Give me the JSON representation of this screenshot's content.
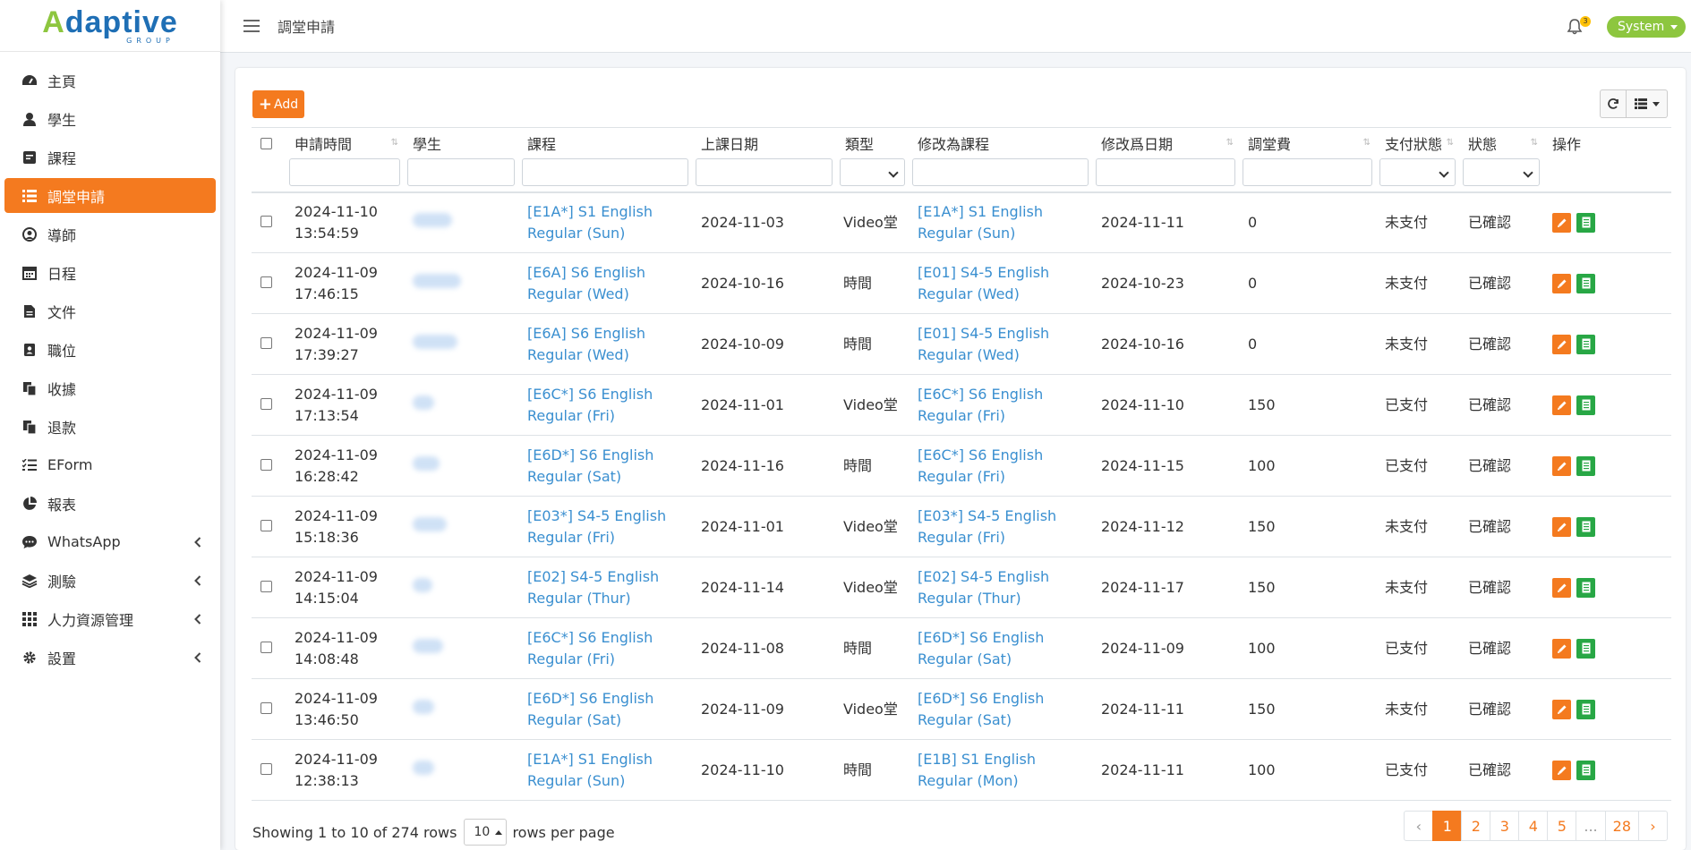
{
  "brand": {
    "name": "Adaptive",
    "sub": "GROUP",
    "green": "#8dc63f",
    "blue": "#1f6fb5",
    "accent": "#f47a1f"
  },
  "sidebar": {
    "items": [
      {
        "label": "主頁",
        "icon": "dashboard-icon"
      },
      {
        "label": "學生",
        "icon": "user-icon"
      },
      {
        "label": "課程",
        "icon": "course-icon"
      },
      {
        "label": "調堂申請",
        "icon": "list-icon",
        "active": true
      },
      {
        "label": "導師",
        "icon": "user-circle-icon"
      },
      {
        "label": "日程",
        "icon": "calendar-icon"
      },
      {
        "label": "文件",
        "icon": "file-icon"
      },
      {
        "label": "職位",
        "icon": "id-badge-icon"
      },
      {
        "label": "收據",
        "icon": "copy-icon"
      },
      {
        "label": "退款",
        "icon": "copy-icon"
      },
      {
        "label": "EForm",
        "icon": "tasks-icon"
      },
      {
        "label": "報表",
        "icon": "pie-chart-icon"
      },
      {
        "label": "WhatsApp",
        "icon": "chat-icon",
        "expandable": true
      },
      {
        "label": "測驗",
        "icon": "layers-icon",
        "expandable": true
      },
      {
        "label": "人力資源管理",
        "icon": "grid-icon",
        "expandable": true
      },
      {
        "label": "設置",
        "icon": "gear-icon",
        "expandable": true
      }
    ]
  },
  "topbar": {
    "title": "調堂申請",
    "notifications": "3",
    "user": "System"
  },
  "toolbar": {
    "add_label": "Add"
  },
  "table": {
    "columns": [
      "申請時間",
      "學生",
      "課程",
      "上課日期",
      "類型",
      "修改為課程",
      "修改爲日期",
      "調堂費",
      "支付狀態",
      "狀態",
      "操作"
    ],
    "rows": [
      {
        "time1": "2024-11-10",
        "time2": "13:54:59",
        "course": "[E1A*] S1 English Regular (Sun)",
        "date": "2024-11-03",
        "type": "Video堂",
        "new_course": "[E1A*] S1 English Regular (Sun)",
        "new_date": "2024-11-11",
        "fee": "0",
        "pay": "未支付",
        "status": "已確認"
      },
      {
        "time1": "2024-11-09",
        "time2": "17:46:15",
        "course": "[E6A] S6 English Regular (Wed)",
        "date": "2024-10-16",
        "type": "時間",
        "new_course": "[E01] S4-5 English Regular (Wed)",
        "new_date": "2024-10-23",
        "fee": "0",
        "pay": "未支付",
        "status": "已確認"
      },
      {
        "time1": "2024-11-09",
        "time2": "17:39:27",
        "course": "[E6A] S6 English Regular (Wed)",
        "date": "2024-10-09",
        "type": "時間",
        "new_course": "[E01] S4-5 English Regular (Wed)",
        "new_date": "2024-10-16",
        "fee": "0",
        "pay": "未支付",
        "status": "已確認"
      },
      {
        "time1": "2024-11-09",
        "time2": "17:13:54",
        "course": "[E6C*] S6 English Regular (Fri)",
        "date": "2024-11-01",
        "type": "Video堂",
        "new_course": "[E6C*] S6 English Regular (Fri)",
        "new_date": "2024-11-10",
        "fee": "150",
        "pay": "已支付",
        "status": "已確認"
      },
      {
        "time1": "2024-11-09",
        "time2": "16:28:42",
        "course": "[E6D*] S6 English Regular (Sat)",
        "date": "2024-11-16",
        "type": "時間",
        "new_course": "[E6C*] S6 English Regular (Fri)",
        "new_date": "2024-11-15",
        "fee": "100",
        "pay": "已支付",
        "status": "已確認"
      },
      {
        "time1": "2024-11-09",
        "time2": "15:18:36",
        "course": "[E03*] S4-5 English Regular (Fri)",
        "date": "2024-11-01",
        "type": "Video堂",
        "new_course": "[E03*] S4-5 English Regular (Fri)",
        "new_date": "2024-11-12",
        "fee": "150",
        "pay": "未支付",
        "status": "已確認"
      },
      {
        "time1": "2024-11-09",
        "time2": "14:15:04",
        "course": "[E02] S4-5 English Regular (Thur)",
        "date": "2024-11-14",
        "type": "Video堂",
        "new_course": "[E02] S4-5 English Regular (Thur)",
        "new_date": "2024-11-17",
        "fee": "150",
        "pay": "未支付",
        "status": "已確認"
      },
      {
        "time1": "2024-11-09",
        "time2": "14:08:48",
        "course": "[E6C*] S6 English Regular (Fri)",
        "date": "2024-11-08",
        "type": "時間",
        "new_course": "[E6D*] S6 English Regular (Sat)",
        "new_date": "2024-11-09",
        "fee": "100",
        "pay": "已支付",
        "status": "已確認"
      },
      {
        "time1": "2024-11-09",
        "time2": "13:46:50",
        "course": "[E6D*] S6 English Regular (Sat)",
        "date": "2024-11-09",
        "type": "Video堂",
        "new_course": "[E6D*] S6 English Regular (Sat)",
        "new_date": "2024-11-11",
        "fee": "150",
        "pay": "未支付",
        "status": "已確認"
      },
      {
        "time1": "2024-11-09",
        "time2": "12:38:13",
        "course": "[E1A*] S1 English Regular (Sun)",
        "date": "2024-11-10",
        "type": "時間",
        "new_course": "[E1B] S1 English Regular (Mon)",
        "new_date": "2024-11-11",
        "fee": "100",
        "pay": "已支付",
        "status": "已確認"
      }
    ]
  },
  "footer": {
    "showing": "Showing 1 to 10 of 274 rows",
    "page_size": "10",
    "per_page": "rows per page",
    "pages": [
      "‹",
      "1",
      "2",
      "3",
      "4",
      "5",
      "...",
      "28",
      "›"
    ]
  }
}
